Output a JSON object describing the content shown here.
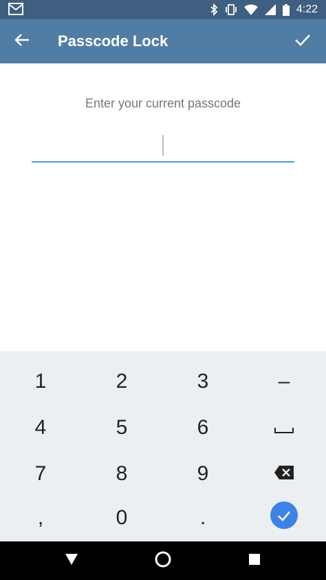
{
  "status_bar": {
    "time": "4:22",
    "notification_icon": "gmail-icon",
    "icons": [
      "bluetooth-icon",
      "vibrate-icon",
      "wifi-icon",
      "signal-icon",
      "battery-icon"
    ]
  },
  "app_bar": {
    "title": "Passcode Lock",
    "back_icon": "arrow-left-icon",
    "confirm_icon": "check-icon",
    "color": "#517ca4"
  },
  "content": {
    "prompt": "Enter your current passcode",
    "passcode_value": ""
  },
  "keyboard": {
    "rows": [
      [
        "1",
        "2",
        "3",
        "–"
      ],
      [
        "4",
        "5",
        "6",
        "space"
      ],
      [
        "7",
        "8",
        "9",
        "backspace"
      ],
      [
        ",",
        "0",
        ".",
        "enter"
      ]
    ],
    "enter_color": "#3f82e6"
  },
  "nav_bar": {
    "buttons": [
      "back-triangle-icon",
      "home-circle-icon",
      "recents-square-icon"
    ]
  }
}
